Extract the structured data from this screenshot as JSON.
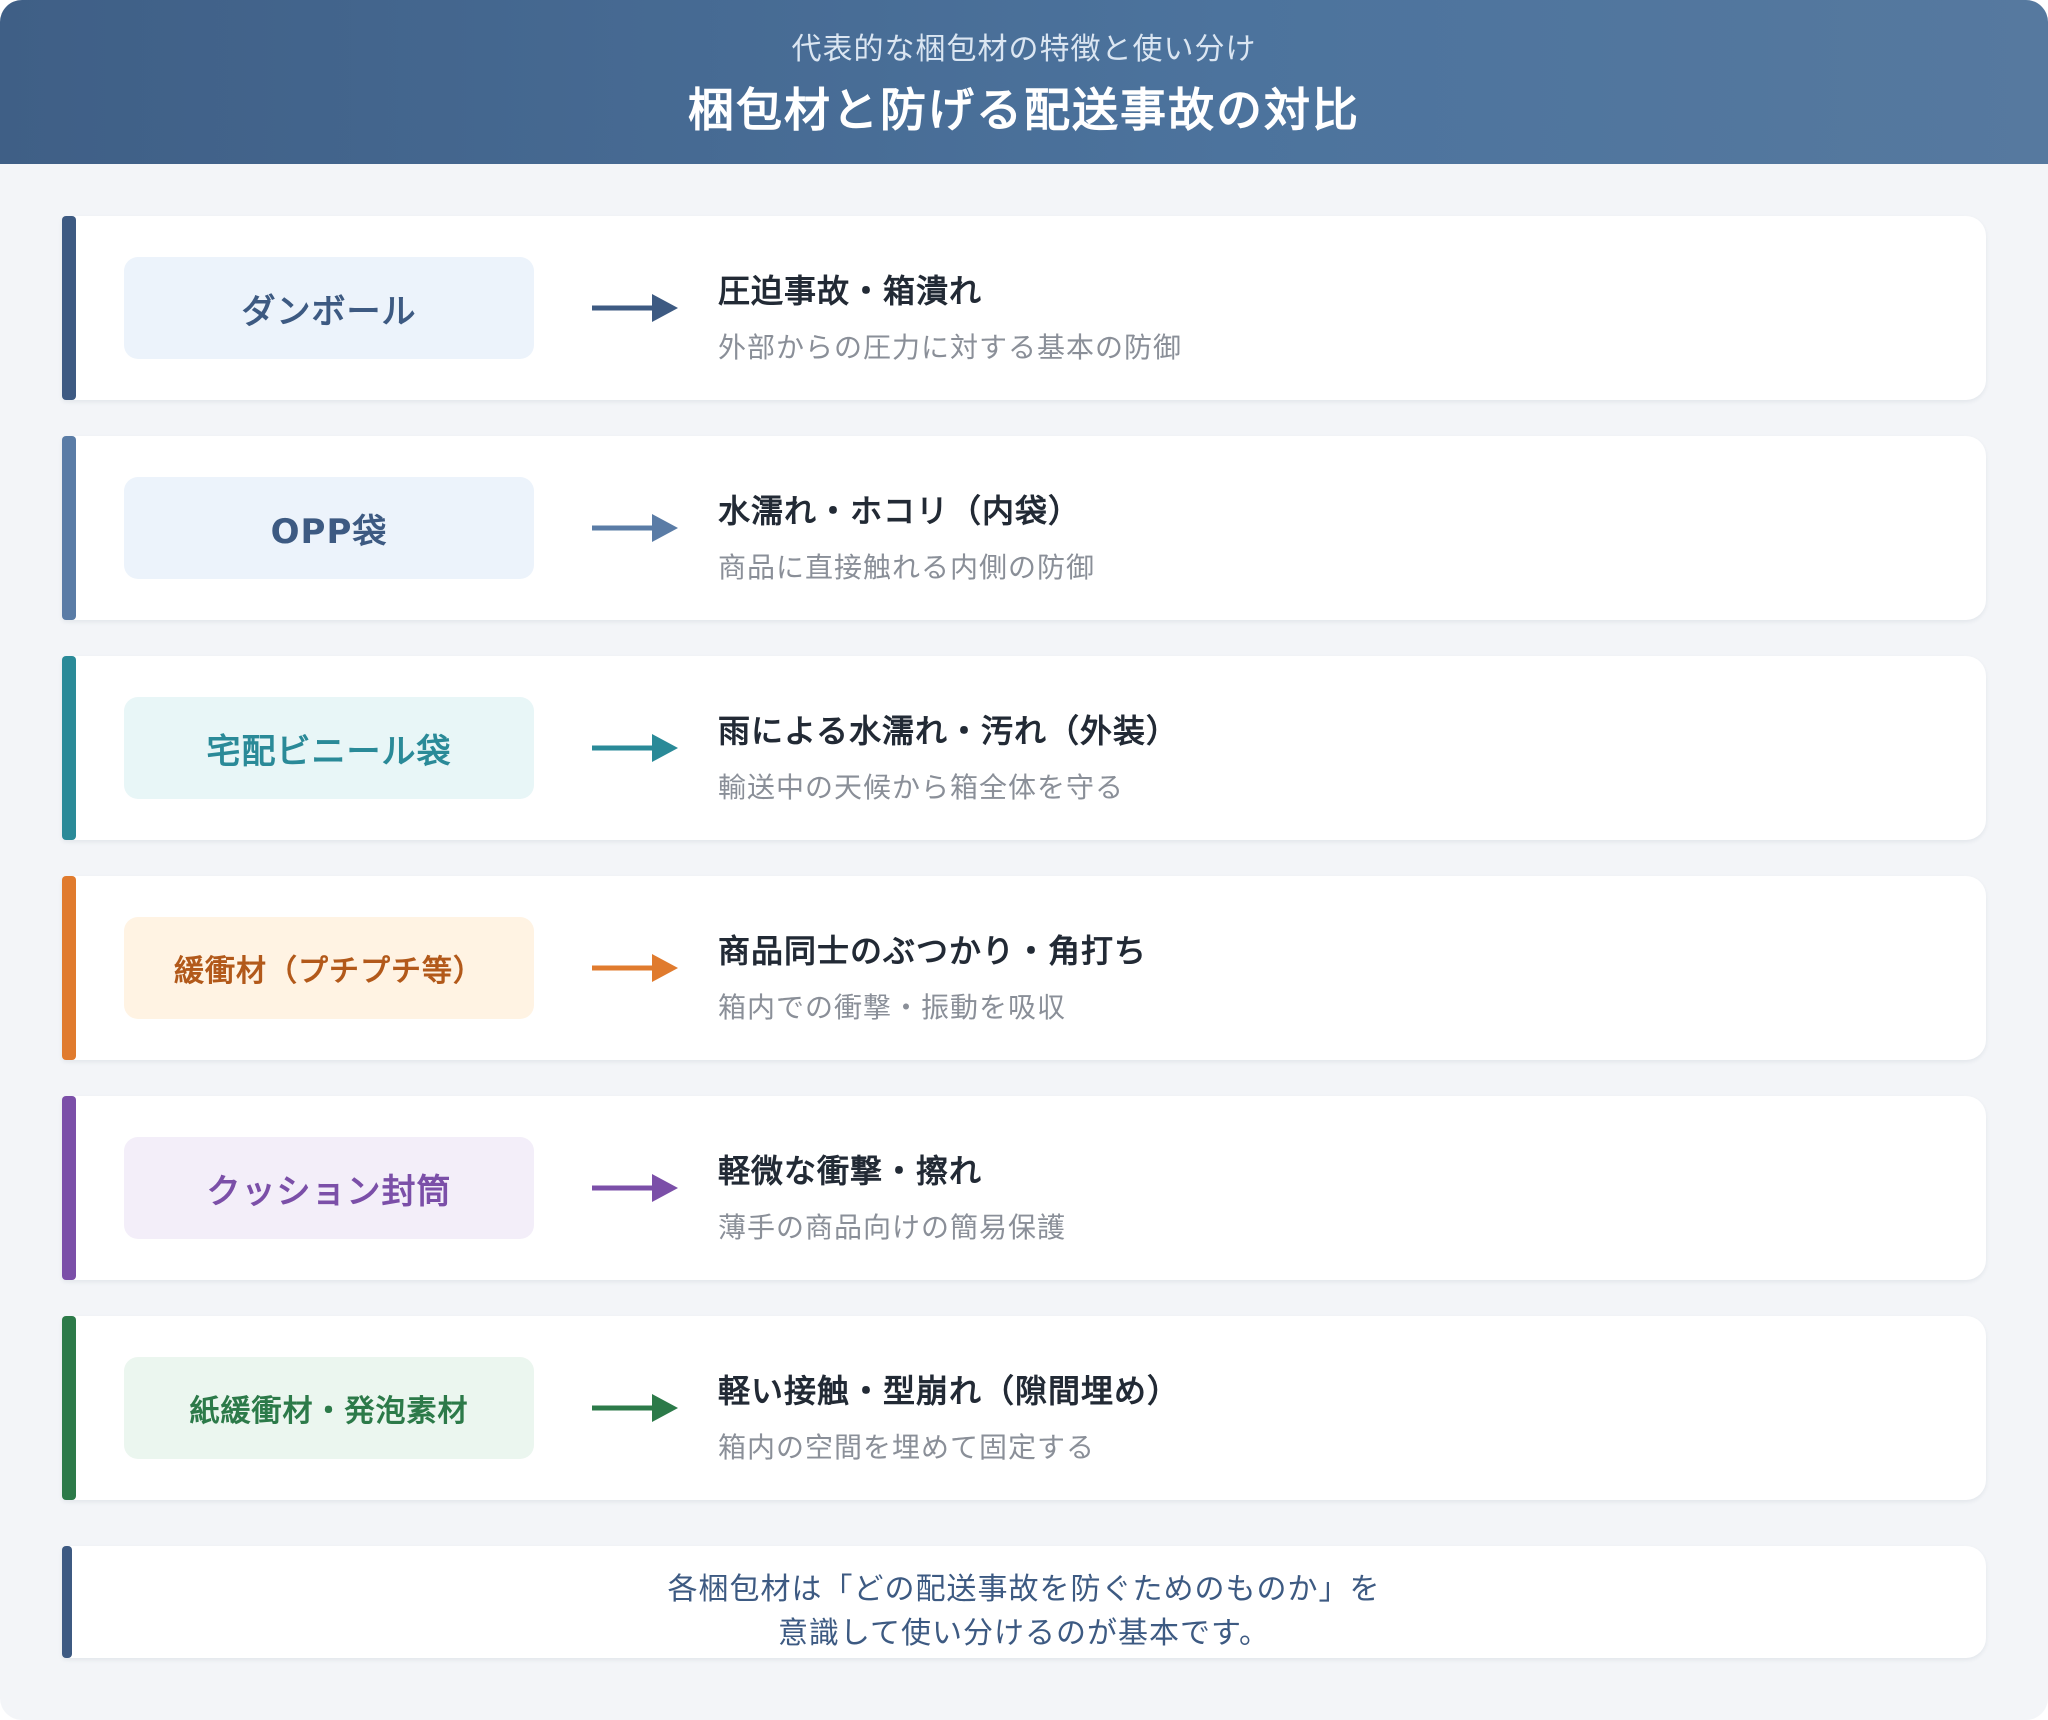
{
  "header": {
    "subtitle": "代表的な梱包材の特徴と使い分け",
    "title": "梱包材と防げる配送事故の対比"
  },
  "rows": [
    {
      "material": "ダンボール",
      "accident": "圧迫事故・箱潰れ",
      "description": "外部からの圧力に対する基本の防御",
      "accent": "#3d5a82",
      "bg": "#ecf3fb",
      "text_color": "#3d5a82"
    },
    {
      "material": "OPP袋",
      "accident": "水濡れ・ホコリ（内袋）",
      "description": "商品に直接触れる内側の防御",
      "accent": "#5a7ca6",
      "bg": "#ecf3fb",
      "text_color": "#3d5a82"
    },
    {
      "material": "宅配ビニール袋",
      "accident": "雨による水濡れ・汚れ（外装）",
      "description": "輸送中の天候から箱全体を守る",
      "accent": "#2a8a98",
      "bg": "#e8f6f7",
      "text_color": "#2a8a98"
    },
    {
      "material": "緩衝材（プチプチ等）",
      "accident": "商品同士のぶつかり・角打ち",
      "description": "箱内での衝撃・振動を吸収",
      "accent": "#e07b2e",
      "bg": "#fff3e3",
      "text_color": "#b2591a"
    },
    {
      "material": "クッション封筒",
      "accident": "軽微な衝撃・擦れ",
      "description": "薄手の商品向けの簡易保護",
      "accent": "#7b4fa8",
      "bg": "#f3eef9",
      "text_color": "#7b4fa8"
    },
    {
      "material": "紙緩衝材・発泡素材",
      "accident": "軽い接触・型崩れ（隙間埋め）",
      "description": "箱内の空間を埋めて固定する",
      "accent": "#2c7a49",
      "bg": "#ebf6ef",
      "text_color": "#2c7a49"
    }
  ],
  "note": {
    "line1": "各梱包材は「どの配送事故を防ぐためのものか」を",
    "line2": "意識して使い分けるのが基本です。"
  }
}
